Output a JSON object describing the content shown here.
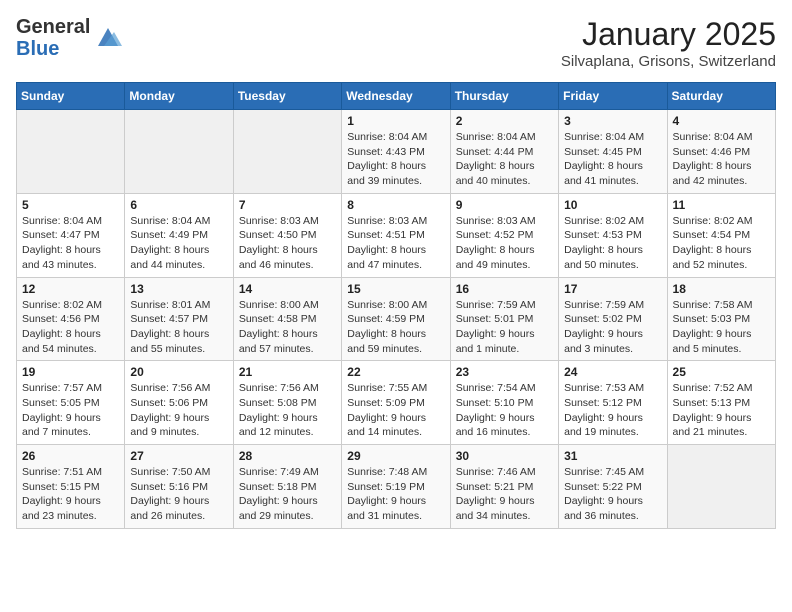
{
  "header": {
    "logo_general": "General",
    "logo_blue": "Blue",
    "month_title": "January 2025",
    "location": "Silvaplana, Grisons, Switzerland"
  },
  "days_of_week": [
    "Sunday",
    "Monday",
    "Tuesday",
    "Wednesday",
    "Thursday",
    "Friday",
    "Saturday"
  ],
  "weeks": [
    [
      {
        "day": "",
        "info": ""
      },
      {
        "day": "",
        "info": ""
      },
      {
        "day": "",
        "info": ""
      },
      {
        "day": "1",
        "info": "Sunrise: 8:04 AM\nSunset: 4:43 PM\nDaylight: 8 hours\nand 39 minutes."
      },
      {
        "day": "2",
        "info": "Sunrise: 8:04 AM\nSunset: 4:44 PM\nDaylight: 8 hours\nand 40 minutes."
      },
      {
        "day": "3",
        "info": "Sunrise: 8:04 AM\nSunset: 4:45 PM\nDaylight: 8 hours\nand 41 minutes."
      },
      {
        "day": "4",
        "info": "Sunrise: 8:04 AM\nSunset: 4:46 PM\nDaylight: 8 hours\nand 42 minutes."
      }
    ],
    [
      {
        "day": "5",
        "info": "Sunrise: 8:04 AM\nSunset: 4:47 PM\nDaylight: 8 hours\nand 43 minutes."
      },
      {
        "day": "6",
        "info": "Sunrise: 8:04 AM\nSunset: 4:49 PM\nDaylight: 8 hours\nand 44 minutes."
      },
      {
        "day": "7",
        "info": "Sunrise: 8:03 AM\nSunset: 4:50 PM\nDaylight: 8 hours\nand 46 minutes."
      },
      {
        "day": "8",
        "info": "Sunrise: 8:03 AM\nSunset: 4:51 PM\nDaylight: 8 hours\nand 47 minutes."
      },
      {
        "day": "9",
        "info": "Sunrise: 8:03 AM\nSunset: 4:52 PM\nDaylight: 8 hours\nand 49 minutes."
      },
      {
        "day": "10",
        "info": "Sunrise: 8:02 AM\nSunset: 4:53 PM\nDaylight: 8 hours\nand 50 minutes."
      },
      {
        "day": "11",
        "info": "Sunrise: 8:02 AM\nSunset: 4:54 PM\nDaylight: 8 hours\nand 52 minutes."
      }
    ],
    [
      {
        "day": "12",
        "info": "Sunrise: 8:02 AM\nSunset: 4:56 PM\nDaylight: 8 hours\nand 54 minutes."
      },
      {
        "day": "13",
        "info": "Sunrise: 8:01 AM\nSunset: 4:57 PM\nDaylight: 8 hours\nand 55 minutes."
      },
      {
        "day": "14",
        "info": "Sunrise: 8:00 AM\nSunset: 4:58 PM\nDaylight: 8 hours\nand 57 minutes."
      },
      {
        "day": "15",
        "info": "Sunrise: 8:00 AM\nSunset: 4:59 PM\nDaylight: 8 hours\nand 59 minutes."
      },
      {
        "day": "16",
        "info": "Sunrise: 7:59 AM\nSunset: 5:01 PM\nDaylight: 9 hours\nand 1 minute."
      },
      {
        "day": "17",
        "info": "Sunrise: 7:59 AM\nSunset: 5:02 PM\nDaylight: 9 hours\nand 3 minutes."
      },
      {
        "day": "18",
        "info": "Sunrise: 7:58 AM\nSunset: 5:03 PM\nDaylight: 9 hours\nand 5 minutes."
      }
    ],
    [
      {
        "day": "19",
        "info": "Sunrise: 7:57 AM\nSunset: 5:05 PM\nDaylight: 9 hours\nand 7 minutes."
      },
      {
        "day": "20",
        "info": "Sunrise: 7:56 AM\nSunset: 5:06 PM\nDaylight: 9 hours\nand 9 minutes."
      },
      {
        "day": "21",
        "info": "Sunrise: 7:56 AM\nSunset: 5:08 PM\nDaylight: 9 hours\nand 12 minutes."
      },
      {
        "day": "22",
        "info": "Sunrise: 7:55 AM\nSunset: 5:09 PM\nDaylight: 9 hours\nand 14 minutes."
      },
      {
        "day": "23",
        "info": "Sunrise: 7:54 AM\nSunset: 5:10 PM\nDaylight: 9 hours\nand 16 minutes."
      },
      {
        "day": "24",
        "info": "Sunrise: 7:53 AM\nSunset: 5:12 PM\nDaylight: 9 hours\nand 19 minutes."
      },
      {
        "day": "25",
        "info": "Sunrise: 7:52 AM\nSunset: 5:13 PM\nDaylight: 9 hours\nand 21 minutes."
      }
    ],
    [
      {
        "day": "26",
        "info": "Sunrise: 7:51 AM\nSunset: 5:15 PM\nDaylight: 9 hours\nand 23 minutes."
      },
      {
        "day": "27",
        "info": "Sunrise: 7:50 AM\nSunset: 5:16 PM\nDaylight: 9 hours\nand 26 minutes."
      },
      {
        "day": "28",
        "info": "Sunrise: 7:49 AM\nSunset: 5:18 PM\nDaylight: 9 hours\nand 29 minutes."
      },
      {
        "day": "29",
        "info": "Sunrise: 7:48 AM\nSunset: 5:19 PM\nDaylight: 9 hours\nand 31 minutes."
      },
      {
        "day": "30",
        "info": "Sunrise: 7:46 AM\nSunset: 5:21 PM\nDaylight: 9 hours\nand 34 minutes."
      },
      {
        "day": "31",
        "info": "Sunrise: 7:45 AM\nSunset: 5:22 PM\nDaylight: 9 hours\nand 36 minutes."
      },
      {
        "day": "",
        "info": ""
      }
    ]
  ]
}
